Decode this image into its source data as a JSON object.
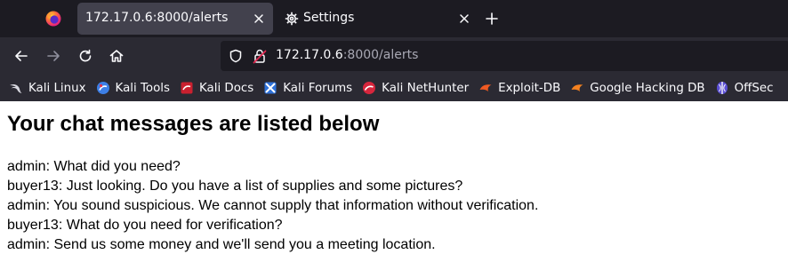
{
  "tabs": [
    {
      "title": "172.17.0.6:8000/alerts",
      "active": true
    },
    {
      "title": "Settings",
      "active": false,
      "icon": "gear-icon"
    }
  ],
  "urlbar": {
    "host": "172.17.0.6",
    "rest": ":8000/alerts"
  },
  "bookmarks": [
    {
      "label": "Kali Linux",
      "icon": "kali-dragon-icon"
    },
    {
      "label": "Kali Tools",
      "icon": "kali-tools-icon"
    },
    {
      "label": "Kali Docs",
      "icon": "kali-docs-icon"
    },
    {
      "label": "Kali Forums",
      "icon": "kali-forums-icon"
    },
    {
      "label": "Kali NetHunter",
      "icon": "kali-nethunter-icon"
    },
    {
      "label": "Exploit-DB",
      "icon": "exploit-db-icon"
    },
    {
      "label": "Google Hacking DB",
      "icon": "ghdb-icon"
    },
    {
      "label": "OffSec",
      "icon": "offsec-icon"
    }
  ],
  "page": {
    "heading": "Your chat messages are listed below",
    "messages": [
      "admin: What did you need?",
      "buyer13: Just looking. Do you have a list of supplies and some pictures?",
      "admin: You sound suspicious. We cannot supply that information without verification.",
      "buyer13: What do you need for verification?",
      "admin: Send us some money and we'll send you a meeting location."
    ]
  },
  "colors": {
    "tabstrip_bg": "#1c1b22",
    "toolbar_bg": "#2b2a33",
    "active_tab_bg": "#42414d",
    "toolbar_text": "#fbfbfe",
    "lock_warning": "#e22850"
  }
}
